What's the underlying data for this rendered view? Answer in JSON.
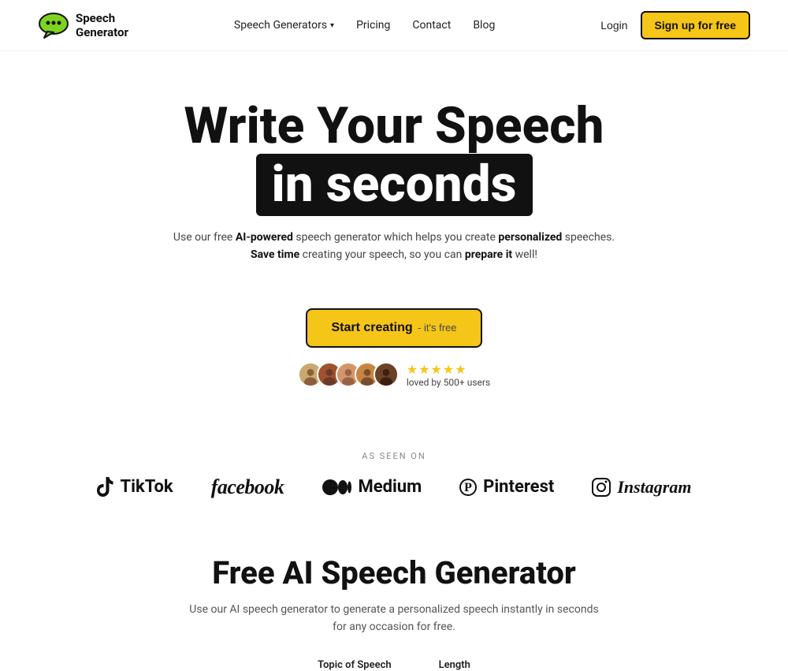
{
  "header": {
    "logo_text_line1": "Speech",
    "logo_text_line2": "Generator",
    "nav": {
      "generators_label": "Speech Generators",
      "pricing_label": "Pricing",
      "contact_label": "Contact",
      "blog_label": "Blog"
    },
    "auth": {
      "login_label": "Login",
      "signup_label": "Sign up for free"
    }
  },
  "hero": {
    "title_line1": "Write Your Speech",
    "title_line2": "in seconds",
    "subtitle_line1_prefix": "Use our free ",
    "subtitle_line1_bold": "AI-powered",
    "subtitle_line1_suffix": " speech generator which helps you create ",
    "subtitle_line1_bold2": "personalized",
    "subtitle_line1_end": " speeches.",
    "subtitle_line2_prefix": "",
    "subtitle_line2_bold": "Save time",
    "subtitle_line2_suffix": " creating your speech, so you can ",
    "subtitle_line2_bold2": "prepare it",
    "subtitle_line2_end": " well!",
    "cta_label": "Start creating",
    "cta_suffix": "- it's free",
    "social_proof": {
      "stars": "★★★★★",
      "loved_text": "loved by 500+ users"
    }
  },
  "as_seen_on": {
    "label": "AS SEEN ON",
    "brands": [
      {
        "name": "TikTok",
        "icon": "tiktok"
      },
      {
        "name": "facebook",
        "icon": "facebook"
      },
      {
        "name": "Medium",
        "icon": "medium"
      },
      {
        "name": "Pinterest",
        "icon": "pinterest"
      },
      {
        "name": "Instagram",
        "icon": "instagram"
      }
    ]
  },
  "section": {
    "heading": "Free AI Speech Generator",
    "description_line1": "Use our AI speech generator to generate a personalized speech instantly in seconds",
    "description_line2": "for any occasion for free.",
    "field1_label": "Topic of Speech",
    "field2_label": "Length"
  }
}
